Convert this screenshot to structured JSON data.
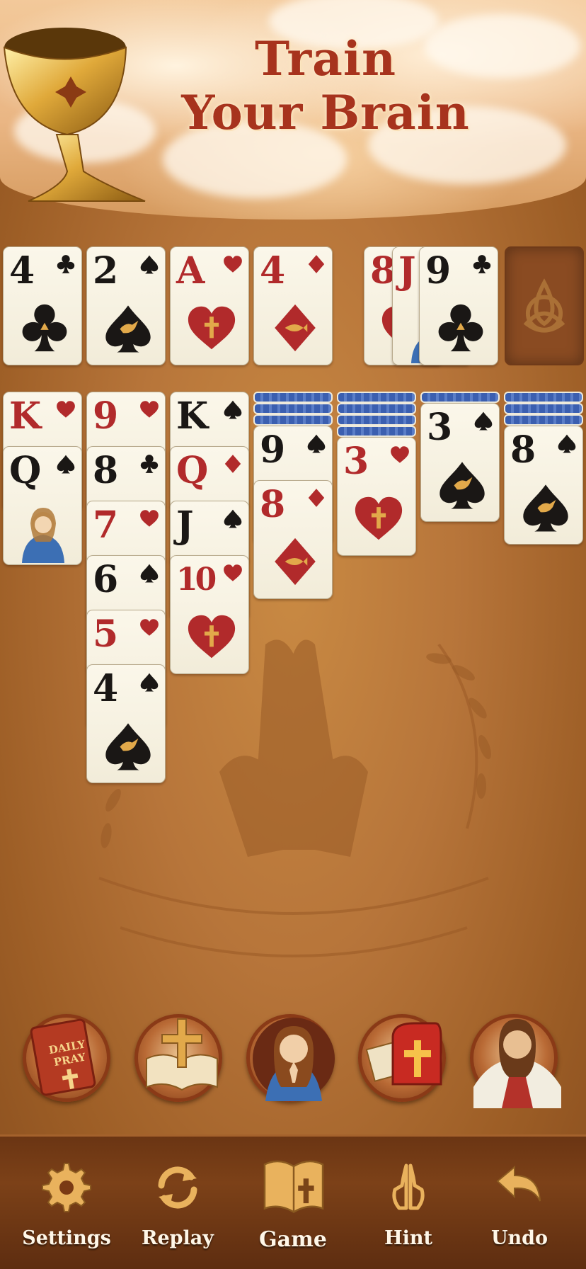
{
  "banner": {
    "title_line1": "Train",
    "title_line2": "Your Brain"
  },
  "foundations": [
    {
      "rank": "4",
      "suit": "club",
      "color": "black"
    },
    {
      "rank": "2",
      "suit": "spade",
      "color": "black"
    },
    {
      "rank": "A",
      "suit": "heart",
      "color": "red"
    },
    {
      "rank": "4",
      "suit": "diamond",
      "color": "red"
    }
  ],
  "waste": [
    {
      "rank": "8",
      "suit": "heart",
      "color": "red"
    },
    {
      "rank": "J",
      "suit": "heart",
      "color": "red"
    },
    {
      "rank": "9",
      "suit": "club",
      "color": "black"
    }
  ],
  "tableau": [
    {
      "face_down": 0,
      "cards": [
        {
          "rank": "K",
          "suit": "heart",
          "color": "red"
        },
        {
          "rank": "Q",
          "suit": "spade",
          "color": "black"
        }
      ]
    },
    {
      "face_down": 0,
      "cards": [
        {
          "rank": "9",
          "suit": "heart",
          "color": "red"
        },
        {
          "rank": "8",
          "suit": "club",
          "color": "black"
        },
        {
          "rank": "7",
          "suit": "heart",
          "color": "red"
        },
        {
          "rank": "6",
          "suit": "spade",
          "color": "black"
        },
        {
          "rank": "5",
          "suit": "heart",
          "color": "red"
        },
        {
          "rank": "4",
          "suit": "spade",
          "color": "black"
        }
      ]
    },
    {
      "face_down": 0,
      "cards": [
        {
          "rank": "K",
          "suit": "spade",
          "color": "black"
        },
        {
          "rank": "Q",
          "suit": "diamond",
          "color": "red"
        },
        {
          "rank": "J",
          "suit": "spade",
          "color": "black"
        },
        {
          "rank": "10",
          "suit": "heart",
          "color": "red"
        }
      ]
    },
    {
      "face_down": 3,
      "cards": [
        {
          "rank": "9",
          "suit": "spade",
          "color": "black"
        },
        {
          "rank": "8",
          "suit": "diamond",
          "color": "red"
        }
      ]
    },
    {
      "face_down": 4,
      "cards": [
        {
          "rank": "3",
          "suit": "heart",
          "color": "red"
        }
      ]
    },
    {
      "face_down": 1,
      "cards": [
        {
          "rank": "3",
          "suit": "spade",
          "color": "black"
        }
      ]
    },
    {
      "face_down": 3,
      "cards": [
        {
          "rank": "8",
          "suit": "spade",
          "color": "black"
        }
      ]
    }
  ],
  "features": [
    {
      "name": "daily-pray",
      "book_text_1": "DAILY",
      "book_text_2": "PRAY"
    },
    {
      "name": "bible"
    },
    {
      "name": "mary-prayer"
    },
    {
      "name": "mailbox"
    },
    {
      "name": "jesus"
    }
  ],
  "bottom_nav": [
    {
      "id": "settings",
      "label": "Settings",
      "icon": "gear-icon"
    },
    {
      "id": "replay",
      "label": "Replay",
      "icon": "replay-icon"
    },
    {
      "id": "game",
      "label": "Game",
      "icon": "bible-book-icon"
    },
    {
      "id": "hint",
      "label": "Hint",
      "icon": "praying-hands-icon"
    },
    {
      "id": "undo",
      "label": "Undo",
      "icon": "undo-arrow-icon"
    }
  ],
  "colors": {
    "red_suit": "#b12a2b",
    "black_suit": "#1a1715",
    "title": "#a7331d",
    "table": "#b7753a"
  }
}
